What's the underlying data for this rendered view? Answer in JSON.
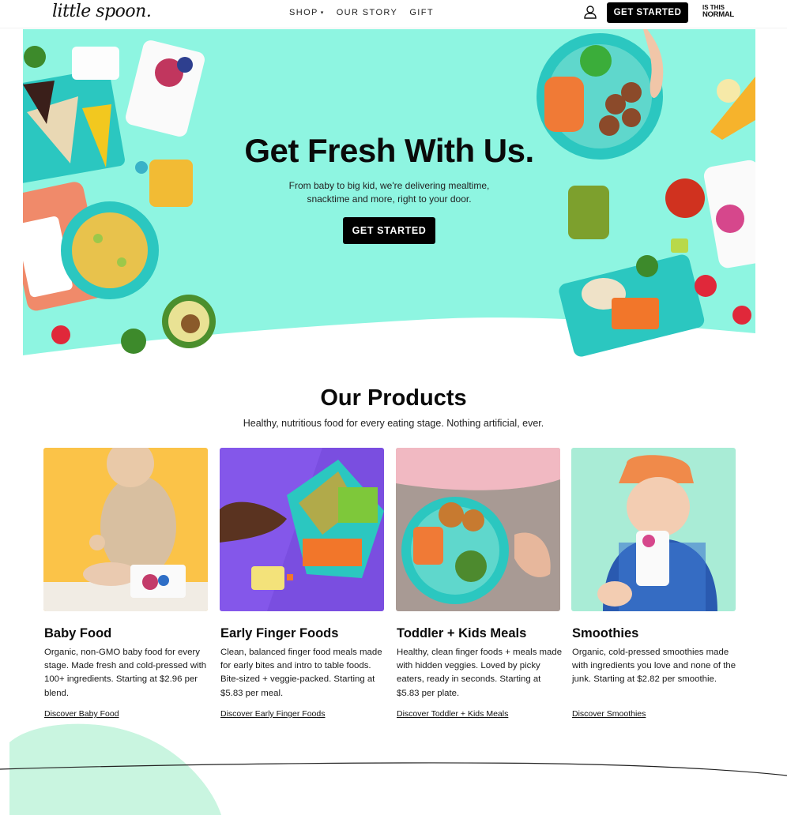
{
  "header": {
    "logo": "little spoon.",
    "nav": [
      {
        "label": "SHOP",
        "caret": "▾"
      },
      {
        "label": "OUR STORY"
      },
      {
        "label": "GIFT"
      }
    ],
    "cta": "GET STARTED",
    "badge": {
      "line1": "IS THIS",
      "line2": "NORMAL"
    }
  },
  "hero": {
    "title": "Get Fresh With Us.",
    "subtitle_line1": "From baby to big kid, we're delivering mealtime,",
    "subtitle_line2": "snacktime and more, right to your door.",
    "cta": "GET STARTED",
    "background_color": "#8ef5e1"
  },
  "products": {
    "title": "Our Products",
    "subtitle": "Healthy, nutritious food for every eating stage. Nothing artificial, ever.",
    "items": [
      {
        "name": "Baby Food",
        "description": "Organic, non-GMO baby food for every stage. Made fresh and cold-pressed with 100+ ingredients. Starting at $2.96 per blend.",
        "link": "Discover Baby Food",
        "bg_color": "#fbc348"
      },
      {
        "name": "Early Finger Foods",
        "description": "Clean, balanced finger food meals made for early bites and intro to table foods. Bite-sized + veggie-packed. Starting at $5.83 per meal.",
        "link": "Discover Early Finger Foods",
        "bg_color": "#7a4ee0"
      },
      {
        "name": "Toddler + Kids Meals",
        "description": "Healthy, clean finger foods + meals made with hidden veggies. Loved by picky eaters, ready in seconds. Starting at $5.83 per plate.",
        "link": "Discover Toddler + Kids Meals",
        "bg_color": "#a89a94"
      },
      {
        "name": "Smoothies",
        "description": "Organic, cold-pressed smoothies made with ingredients you love and none of the junk. Starting at $2.82 per smoothie.",
        "link": "Discover Smoothies",
        "bg_color": "#a9ecd6"
      }
    ]
  }
}
